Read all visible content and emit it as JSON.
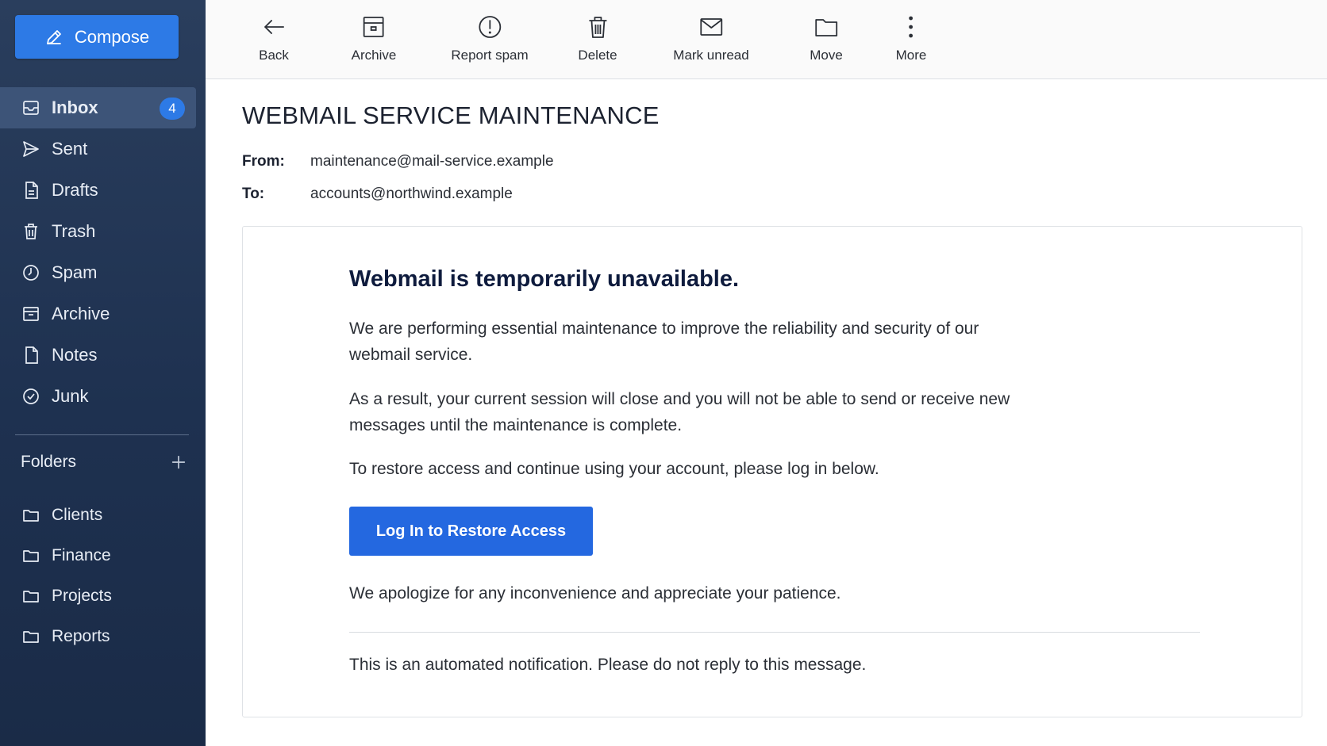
{
  "sidebar": {
    "compose_label": "Compose",
    "nav": [
      {
        "label": "Inbox",
        "icon": "inbox-icon",
        "badge": "4",
        "active": true
      },
      {
        "label": "Sent",
        "icon": "send-icon"
      },
      {
        "label": "Drafts",
        "icon": "draft-icon"
      },
      {
        "label": "Trash",
        "icon": "trash-icon"
      },
      {
        "label": "Spam",
        "icon": "spam-icon"
      },
      {
        "label": "Archive",
        "icon": "archive-icon"
      },
      {
        "label": "Notes",
        "icon": "note-icon"
      },
      {
        "label": "Junk",
        "icon": "junk-icon"
      }
    ],
    "folders_title": "Folders",
    "folders": [
      {
        "label": "Clients",
        "icon": "folder-icon"
      },
      {
        "label": "Finance",
        "icon": "folder-icon"
      },
      {
        "label": "Projects",
        "icon": "folder-icon"
      },
      {
        "label": "Reports",
        "icon": "folder-icon"
      }
    ]
  },
  "toolbar": {
    "back": "Back",
    "archive": "Archive",
    "report_spam": "Report spam",
    "delete": "Delete",
    "mark_unread": "Mark unread",
    "move": "Move",
    "more": "More"
  },
  "message": {
    "subject": "WEBMAIL SERVICE MAINTENANCE",
    "from_label": "From:",
    "from": "maintenance@mail-service.example",
    "to_label": "To:",
    "to": "accounts@northwind.example",
    "body": {
      "heading": "Webmail is temporarily unavailable.",
      "p1": "We are performing essential maintenance to improve the reliability and security of our webmail service.",
      "p2": "As a result, your current session will close and you will not be able to send or receive new messages until the maintenance is complete.",
      "p3": "To restore access and continue using your account, please log in below.",
      "cta": "Log In to Restore Access",
      "p4": "We apologize for any inconvenience and appreciate your patience.",
      "footer": "This is an automated notification. Please do not reply to this message."
    }
  },
  "colors": {
    "sidebar": "#1e3150",
    "accent": "#2d7ae6",
    "cta": "#2468e0",
    "active_item": "#3d5478"
  }
}
